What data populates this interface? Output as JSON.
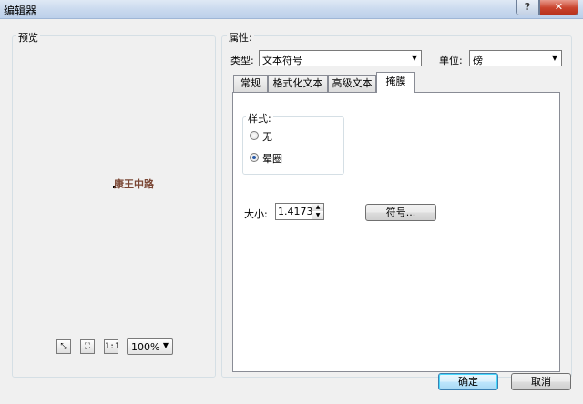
{
  "window": {
    "title": "编辑器",
    "help_label": "?",
    "close_label": "✕"
  },
  "preview": {
    "group_label": "预览",
    "sample_text": "康王中路",
    "tools": {
      "zoom_fit_glyph": "⤡",
      "zoom_full_glyph": "⛶",
      "actual_size_label": "1:1"
    },
    "zoom_value": "100%"
  },
  "properties": {
    "group_label": "属性:",
    "type_label": "类型:",
    "type_value": "文本符号",
    "unit_label": "单位:",
    "unit_value": "磅",
    "tabs": [
      {
        "label": "常规"
      },
      {
        "label": "格式化文本"
      },
      {
        "label": "高级文本"
      },
      {
        "label": "掩膜"
      }
    ],
    "mask": {
      "style_label": "样式:",
      "options": [
        {
          "label": "无",
          "checked": false
        },
        {
          "label": "晕圈",
          "checked": true
        }
      ],
      "size_label": "大小:",
      "size_value": "1.4173",
      "symbol_button": "符号..."
    }
  },
  "footer": {
    "ok_label": "确定",
    "cancel_label": "取消"
  }
}
